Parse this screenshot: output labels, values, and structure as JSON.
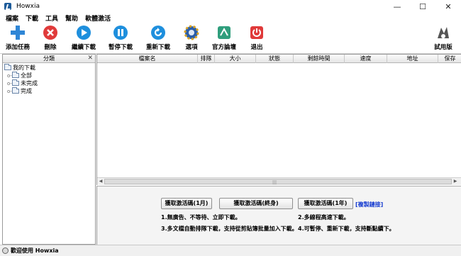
{
  "window": {
    "title": "Howxia"
  },
  "menu": [
    "檔案",
    "下載",
    "工具",
    "幫助",
    "軟體激活"
  ],
  "toolbar": [
    {
      "label": "添加任務",
      "icon": "add-icon",
      "color": "#2f86d6"
    },
    {
      "label": "刪除",
      "icon": "delete-icon",
      "color": "#e03a3a"
    },
    {
      "label": "繼續下載",
      "icon": "play-icon",
      "color": "#1e8fdd"
    },
    {
      "label": "暫停下載",
      "icon": "pause-icon",
      "color": "#1e8fdd"
    },
    {
      "label": "重新下載",
      "icon": "refresh-icon",
      "color": "#1e8fdd"
    },
    {
      "label": "選項",
      "icon": "gear-icon",
      "color": "#2b5ea8"
    },
    {
      "label": "官方論壇",
      "icon": "forum-icon",
      "color": "#2f9e7c"
    },
    {
      "label": "退出",
      "icon": "power-icon",
      "color": "#e03a3a"
    },
    {
      "label": "試用版",
      "icon": "trial-icon",
      "color": "#555555"
    }
  ],
  "left_panel": {
    "title": "分類",
    "tree": {
      "root": "我的下載",
      "children": [
        "全部",
        "未完成",
        "完成"
      ]
    }
  },
  "table": {
    "columns": [
      "檔案名",
      "排隊",
      "大小",
      "狀態",
      "剩餘時間",
      "速度",
      "地址",
      "保存"
    ]
  },
  "bottom": {
    "buttons": [
      "獲取激活碼(1月)",
      "獲取激活碼(終身)",
      "獲取激活碼(1年)"
    ],
    "copy_link": "[複製鏈接]",
    "notes": [
      "1.無廣告、不等待、立即下載。",
      "2.多線程高速下載。",
      "3.多文檔自動排隊下載，支持從剪貼簿批量加入下載。",
      "4.可暫停、重新下載，支持斷點續下。"
    ]
  },
  "status": {
    "text": "歡迎使用 Howxia"
  }
}
